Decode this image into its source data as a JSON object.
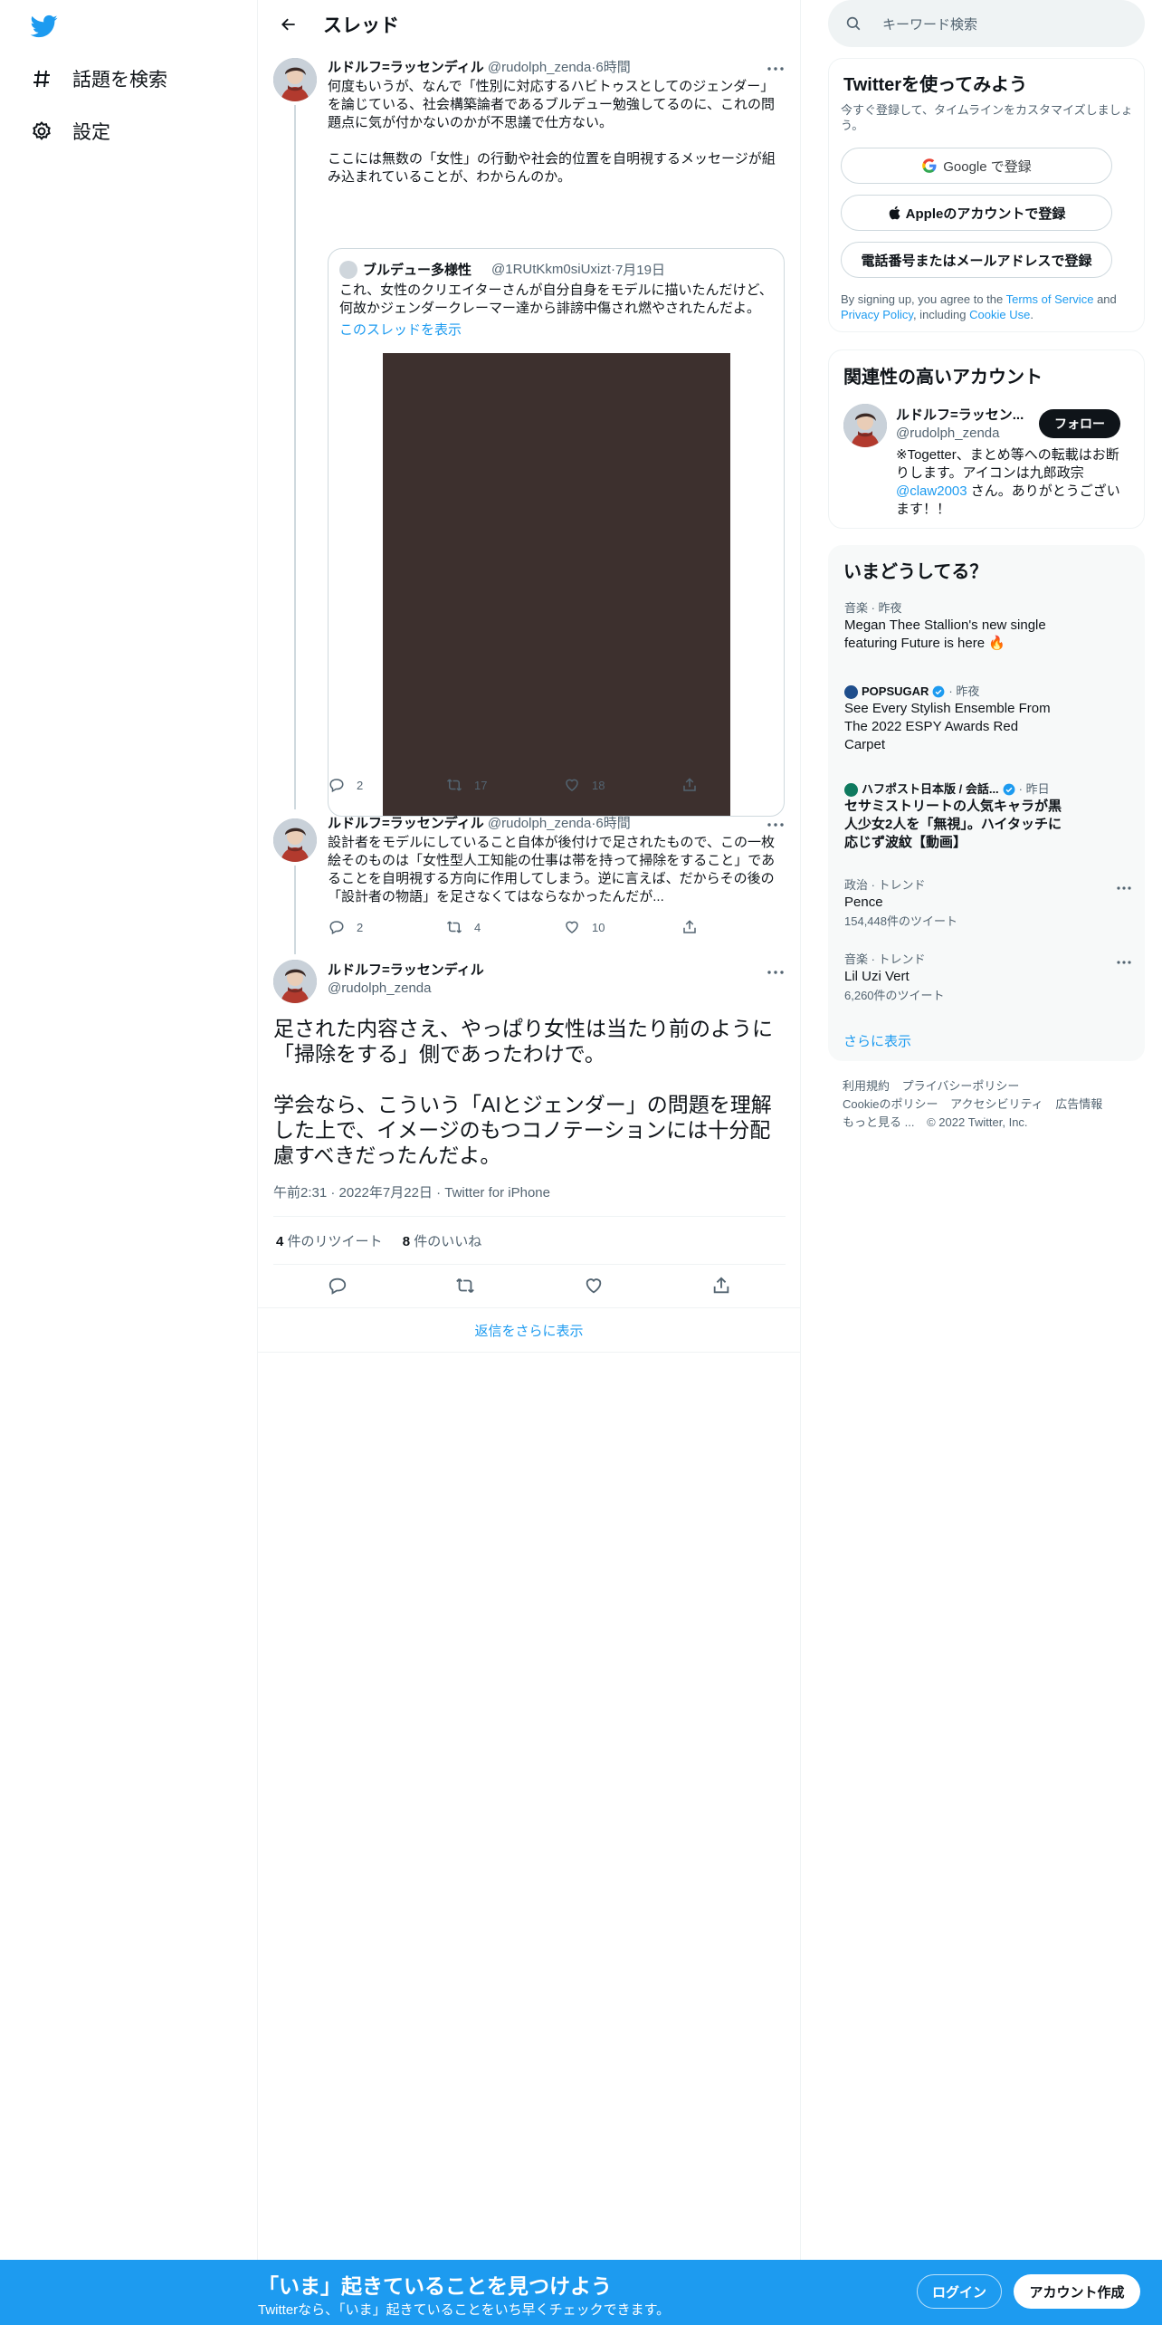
{
  "colors": {
    "accent": "#1d9bf0",
    "text": "#0f1419",
    "muted": "#536471",
    "image_bg": "#3d302e"
  },
  "nav": {
    "explore": "話題を検索",
    "settings": "設定"
  },
  "header": {
    "title": "スレッド"
  },
  "tweet1": {
    "name": "ルドルフ=ラッセンディル",
    "handle": "@rudolph_zenda",
    "sep": "·",
    "time": "6時間",
    "text1": "何度もいうが、なんで「性別に対応するハビトゥスとしてのジェンダー」を論じている、社会構築論者であるブルデュー勉強してるのに、これの問題点に気が付かないのかが不思議で仕方ない。",
    "text2": "ここには無数の「女性」の行動や社会的位置を自明視するメッセージが組み込まれていることが、わからんのか。",
    "quote": {
      "name": "ブルデュー多様性",
      "handle": "@1RUtKkm0siUxizt",
      "sep": "·",
      "date": "7月19日",
      "text": "これ、女性のクリエイターさんが自分自身をモデルに描いたんだけど、何故かジェンダークレーマー達から誹謗中傷され燃やされたんだよ。",
      "link": "このスレッドを表示"
    },
    "replies": "2",
    "retweets": "17",
    "likes": "18"
  },
  "tweet2": {
    "name": "ルドルフ=ラッセンディル",
    "handle": "@rudolph_zenda",
    "sep": "·",
    "time": "6時間",
    "text": "設計者をモデルにしていること自体が後付けで足されたもので、この一枚絵そのものは「女性型人工知能の仕事は帯を持って掃除をすること」であることを自明視する方向に作用してしまう。逆に言えば、だからその後の「設計者の物語」を足さなくてはならなかったんだが...",
    "replies": "2",
    "retweets": "4",
    "likes": "10"
  },
  "main_tweet": {
    "name": "ルドルフ=ラッセンディル",
    "handle": "@rudolph_zenda",
    "text1": "足された内容さえ、やっぱり女性は当たり前のように「掃除をする」側であったわけで。",
    "text2": "学会なら、こういう「AIとジェンダー」の問題を理解した上で、イメージのもつコノテーションには十分配慮すべきだったんだよ。",
    "timestamp": "午前2:31 · 2022年7月22日 · Twitter for iPhone",
    "retweet_count": "4",
    "retweet_label": "件のリツイート",
    "like_count": "8",
    "like_label": "件のいいね"
  },
  "show_more_replies": "返信をさらに表示",
  "search": {
    "placeholder": "キーワード検索"
  },
  "signup": {
    "title": "Twitterを使ってみよう",
    "subtitle": "今すぐ登録して、タイムラインをカスタマイズしましょう。",
    "google": "Google で登録",
    "apple": "Appleのアカウントで登録",
    "phone": "電話番号またはメールアドレスで登録",
    "terms_pre": "By signing up, you agree to the",
    "terms_link": "Terms of Service",
    "and": "and",
    "privacy_link": "Privacy Policy",
    "including": ", including",
    "cookie_link": "Cookie Use",
    "period": "."
  },
  "related": {
    "title": "関連性の高いアカウント",
    "name": "ルドルフ=ラッセン...",
    "handle": "@rudolph_zenda",
    "follow": "フォロー",
    "bio1": "※Togetter、まとめ等への転載はお断りします。アイコンは九郎政宗",
    "bio_link": "@claw2003",
    "bio2": "さん。ありがとうございます！！"
  },
  "trends": {
    "title": "いまどうしてる？",
    "items": [
      {
        "category": "音楽 · 昨夜",
        "title": "Megan Thee Stallion's new single featuring Future is here 🔥"
      },
      {
        "source": "POPSUGAR",
        "when": "· 昨夜",
        "title": "See Every Stylish Ensemble From The 2022 ESPY Awards Red Carpet"
      },
      {
        "source": "ハフポスト日本版 / 会話...",
        "when": "· 昨日",
        "title": "セサミストリートの人気キャラが黒人少女2人を「無視」。ハイタッチに応じず波紋【動画】"
      },
      {
        "category": "政治 · トレンド",
        "title": "Pence",
        "count": "154,448件のツイート"
      },
      {
        "category": "音楽 · トレンド",
        "title": "Lil Uzi Vert",
        "count": "6,260件のツイート"
      }
    ],
    "show_more": "さらに表示"
  },
  "footer": {
    "terms": "利用規約",
    "privacy": "プライバシーポリシー",
    "cookie": "Cookieのポリシー",
    "accessibility": "アクセシビリティ",
    "ads": "広告情報",
    "more": "もっと見る ...",
    "copyright": "© 2022 Twitter, Inc."
  },
  "bottom": {
    "title": "「いま」起きていることを見つけよう",
    "subtitle": "Twitterなら、「いま」起きていることをいち早くチェックできます。",
    "login": "ログイン",
    "signup": "アカウント作成"
  }
}
